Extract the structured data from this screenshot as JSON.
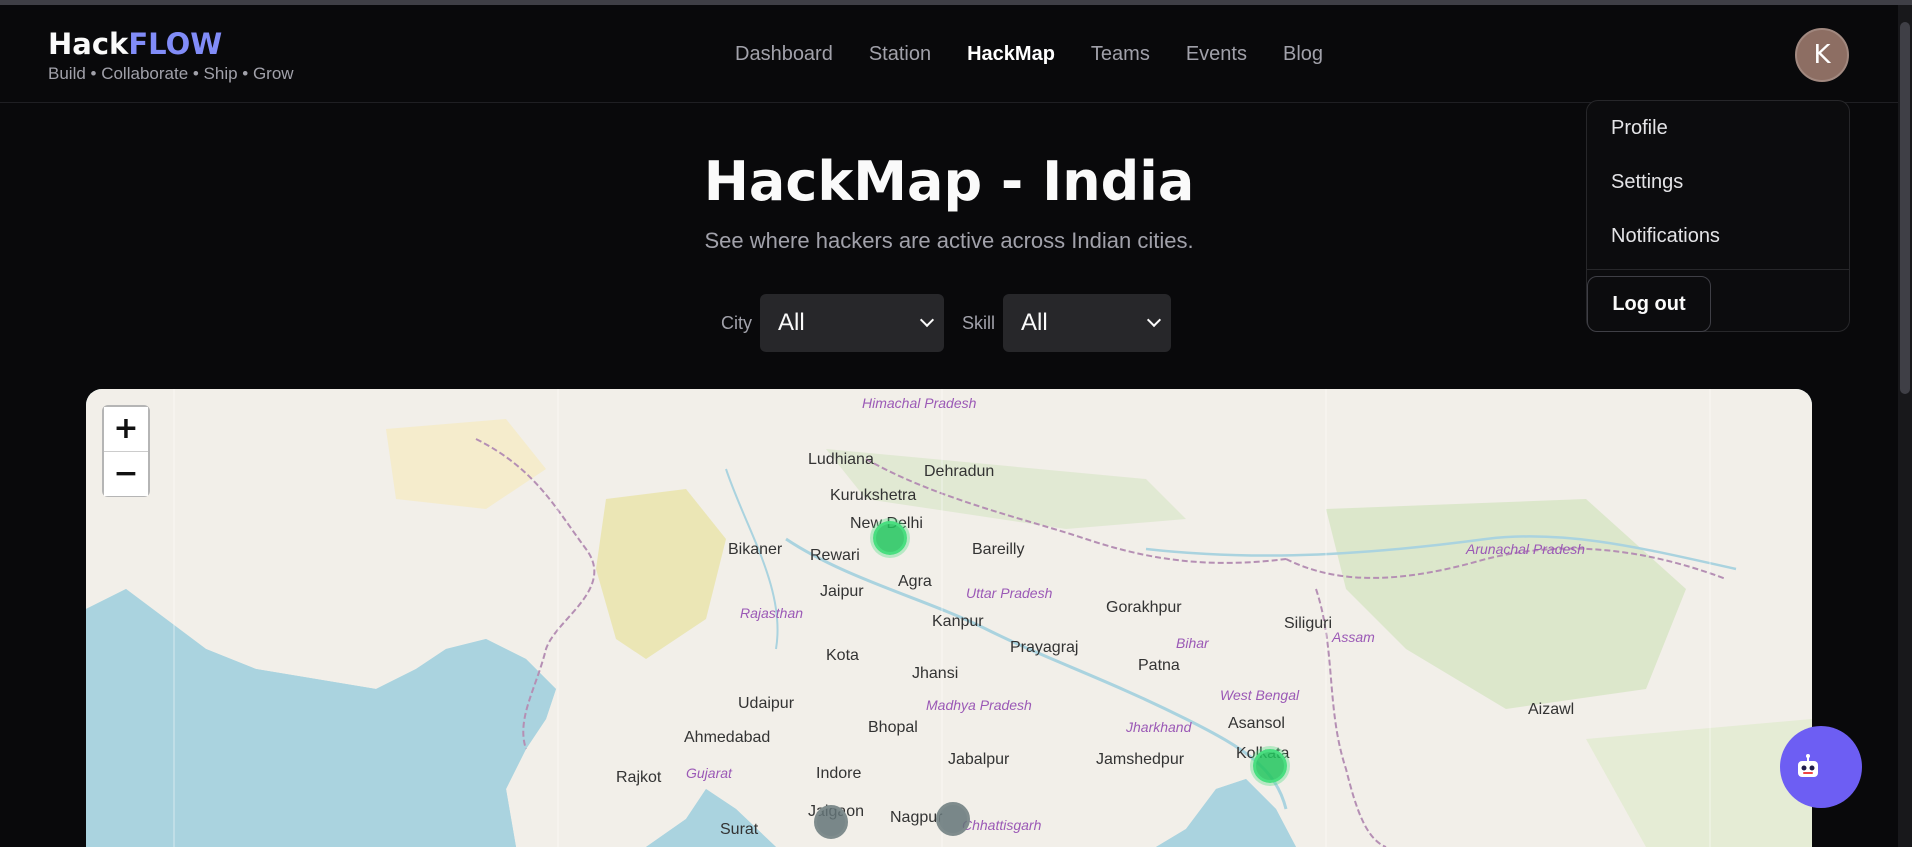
{
  "brand": {
    "name_prefix": "Hack",
    "name_accent": "FLOW",
    "tagline": "Build • Collaborate • Ship • Grow"
  },
  "nav": [
    {
      "label": "Dashboard",
      "active": false
    },
    {
      "label": "Station",
      "active": false
    },
    {
      "label": "HackMap",
      "active": true
    },
    {
      "label": "Teams",
      "active": false
    },
    {
      "label": "Events",
      "active": false
    },
    {
      "label": "Blog",
      "active": false
    }
  ],
  "user": {
    "initial": "K"
  },
  "user_menu": {
    "profile": "Profile",
    "settings": "Settings",
    "notifications": "Notifications",
    "logout": "Log out"
  },
  "page": {
    "title": "HackMap - India",
    "subtitle": "See where hackers are active across Indian cities."
  },
  "filters": {
    "city_label": "City",
    "city_value": "All",
    "skill_label": "Skill",
    "skill_value": "All"
  },
  "map": {
    "zoom_in": "+",
    "zoom_out": "−",
    "cities": [
      "Ludhiana",
      "Dehradun",
      "Kurukshetra",
      "New Delhi",
      "Bikaner",
      "Rewari",
      "Bareilly",
      "Agra",
      "Jaipur",
      "Gorakhpur",
      "Kanpur",
      "Prayagraj",
      "Patna",
      "Siliguri",
      "Kota",
      "Jhansi",
      "Udaipur",
      "Ahmedabad",
      "Bhopal",
      "Aizawl",
      "Asansol",
      "Jabalpur",
      "Jamshedpur",
      "Kolkata",
      "Rajkot",
      "Indore",
      "Jalgaon",
      "Nagpur",
      "Surat"
    ],
    "regions": [
      "Himachal Pradesh",
      "Rajasthan",
      "Uttar Pradesh",
      "Bihar",
      "Assam",
      "Madhya Pradesh",
      "Jharkhand",
      "West Bengal",
      "Gujarat",
      "Chhattisgarh",
      "Arunachal Pradesh"
    ]
  },
  "colors": {
    "accent": "#818cf8",
    "marker_active": "#22c55e",
    "marker_inactive": "#64748b",
    "fab": "#6d5ef3"
  }
}
